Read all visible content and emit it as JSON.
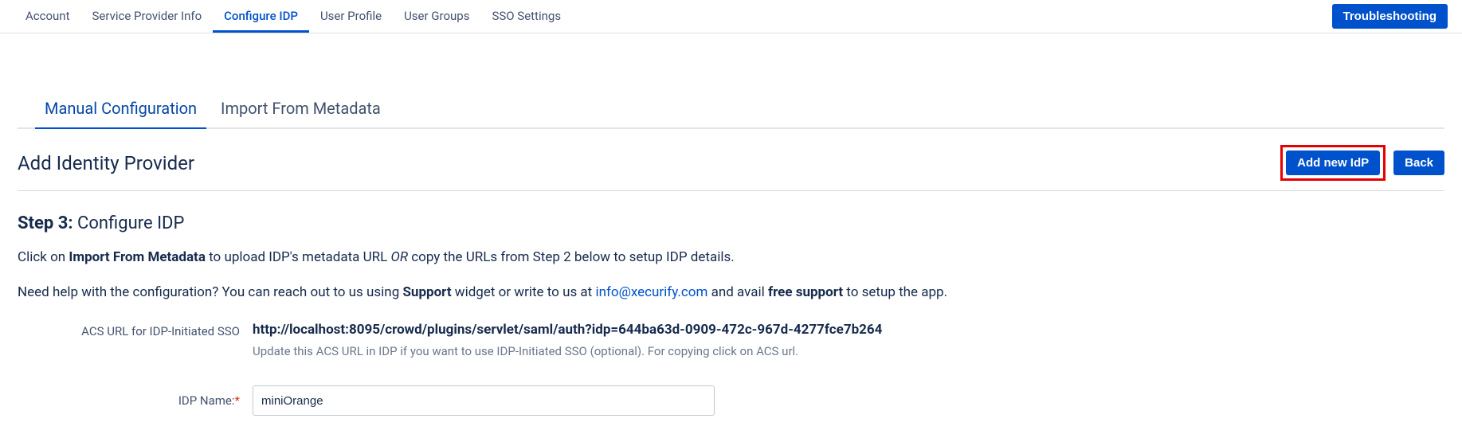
{
  "topNav": {
    "tabs": [
      {
        "label": "Account"
      },
      {
        "label": "Service Provider Info"
      },
      {
        "label": "Configure IDP"
      },
      {
        "label": "User Profile"
      },
      {
        "label": "User Groups"
      },
      {
        "label": "SSO Settings"
      }
    ],
    "troubleshooting": "Troubleshooting"
  },
  "subTabs": [
    {
      "label": "Manual Configuration"
    },
    {
      "label": "Import From Metadata"
    }
  ],
  "section": {
    "title": "Add Identity Provider",
    "addBtn": "Add new IdP",
    "backBtn": "Back"
  },
  "step": {
    "prefix": "Step 3:",
    "title": " Configure IDP"
  },
  "para1": {
    "t1": "Click on ",
    "b1": "Import From Metadata",
    "t2": " to upload IDP's metadata URL ",
    "i1": "OR",
    "t3": " copy the URLs from Step 2 below to setup IDP details."
  },
  "para2": {
    "t1": "Need help with the configuration? You can reach out to us using ",
    "b1": "Support",
    "t2": " widget or write to us at ",
    "link": "info@xecurify.com",
    "t3": " and avail ",
    "b2": "free support",
    "t4": " to setup the app."
  },
  "form": {
    "acsLabel": "ACS URL for IDP-Initiated SSO",
    "acsUrl": "http://localhost:8095/crowd/plugins/servlet/saml/auth?idp=644ba63d-0909-472c-967d-4277fce7b264",
    "acsHint": "Update this ACS URL in IDP if you want to use IDP-Initiated SSO (optional). For copying click on ACS url.",
    "idpNameLabel": "IDP Name:",
    "idpNameValue": "miniOrange"
  }
}
